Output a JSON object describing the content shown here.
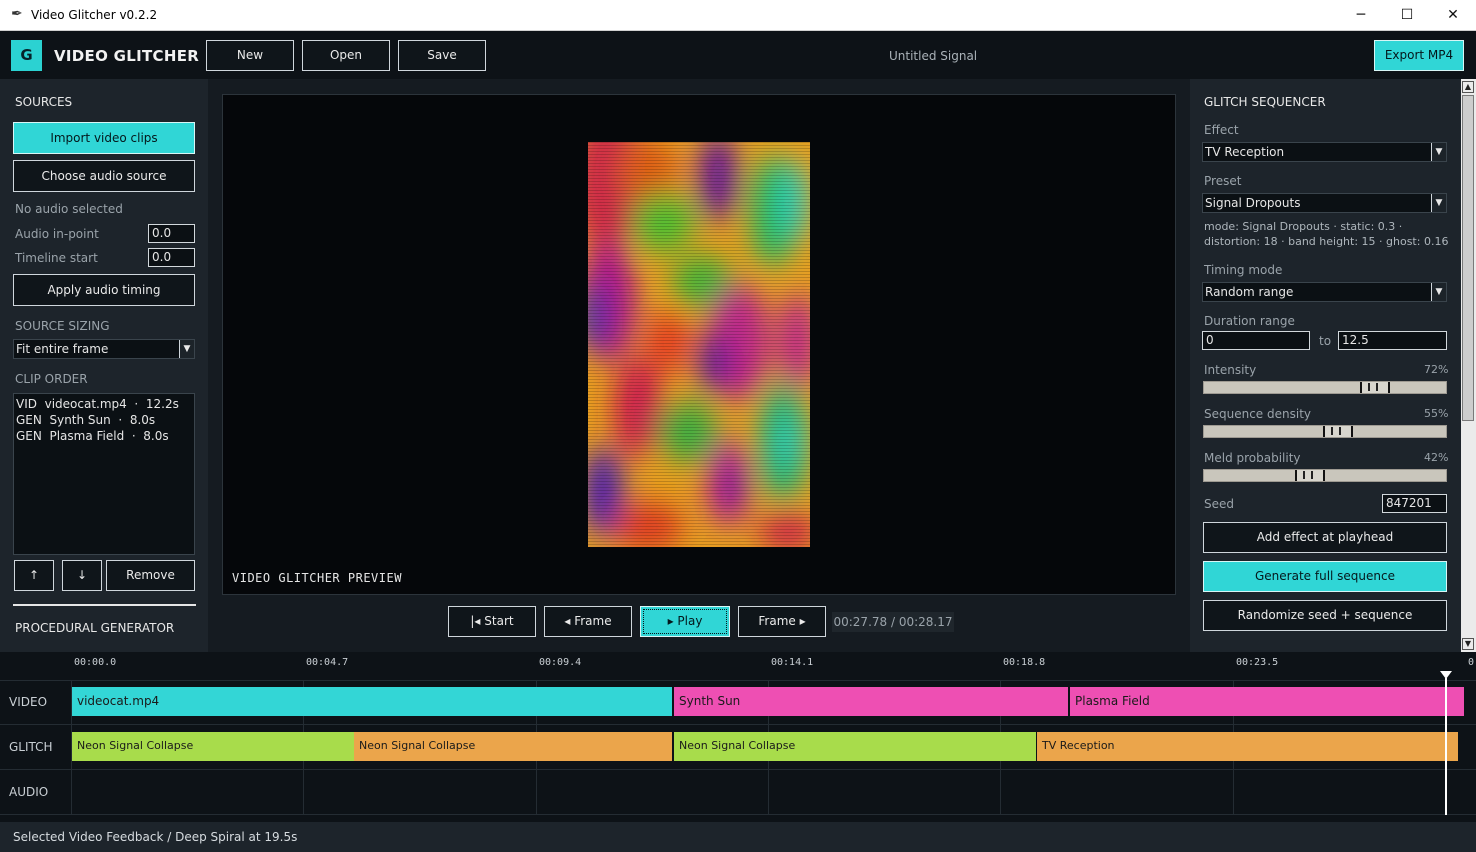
{
  "window": {
    "title": "Video Glitcher v0.2.2",
    "minimize": "─",
    "maximize": "☐",
    "close": "✕",
    "icon": "feather-icon"
  },
  "header": {
    "logo_letter": "G",
    "app_name": "VIDEO GLITCHER",
    "new_label": "New",
    "open_label": "Open",
    "save_label": "Save",
    "doc_title": "Untitled Signal",
    "export_label": "Export MP4"
  },
  "sources": {
    "heading": "SOURCES",
    "import_label": "Import video clips",
    "audio_source_label": "Choose audio source",
    "audio_status": "No audio selected",
    "audio_in_label": "Audio in-point",
    "audio_in_value": "0.0",
    "timeline_start_label": "Timeline start",
    "timeline_start_value": "0.0",
    "apply_timing_label": "Apply audio timing",
    "sizing_heading": "SOURCE SIZING",
    "sizing_value": "Fit entire frame",
    "clip_order_heading": "CLIP ORDER",
    "clips": [
      "VID  videocat.mp4  ·  12.2s",
      "GEN  Synth Sun  ·  8.0s",
      "GEN  Plasma Field  ·  8.0s"
    ],
    "up_label": "↑",
    "down_label": "↓",
    "remove_label": "Remove",
    "procedural_heading": "PROCEDURAL GENERATOR"
  },
  "preview": {
    "label": "VIDEO GLITCHER PREVIEW",
    "start_label": "|◂ Start",
    "frame_back_label": "◂ Frame",
    "play_label": "▸ Play",
    "frame_fwd_label": "Frame ▸",
    "timecode": "00:27.78 / 00:28.17"
  },
  "sequencer": {
    "heading": "GLITCH SEQUENCER",
    "effect_label": "Effect",
    "effect_value": "TV Reception",
    "preset_label": "Preset",
    "preset_value": "Signal Dropouts",
    "preset_desc_1": "mode: Signal Dropouts · static: 0.3 ·",
    "preset_desc_2": "distortion: 18 · band height: 15 · ghost: 0.16",
    "timing_label": "Timing mode",
    "timing_value": "Random range",
    "duration_label": "Duration range",
    "duration_min": "0",
    "duration_to": "to",
    "duration_max": "12.5",
    "intensity_label": "Intensity",
    "intensity_value": "72%",
    "intensity": 0.72,
    "density_label": "Sequence density",
    "density_value": "55%",
    "density": 0.55,
    "meld_label": "Meld probability",
    "meld_value": "42%",
    "meld": 0.42,
    "seed_label": "Seed",
    "seed_value": "847201",
    "add_effect_label": "Add effect at playhead",
    "generate_label": "Generate full sequence",
    "randomize_label": "Randomize seed + sequence",
    "scroll_up": "▲",
    "scroll_down": "▼"
  },
  "timeline": {
    "ruler": [
      "00:00.0",
      "00:04.7",
      "00:09.4",
      "00:14.1",
      "00:18.8",
      "00:23.5",
      "0"
    ],
    "tracks": [
      "VIDEO",
      "GLITCH",
      "AUDIO"
    ],
    "video_clips": [
      {
        "label": "videocat.mp4",
        "color": "#33d6d6"
      },
      {
        "label": "Synth Sun",
        "color": "#ee4fb3"
      },
      {
        "label": "Plasma Field",
        "color": "#ee4fb3"
      }
    ],
    "glitch_clips": [
      {
        "label": "Neon Signal Collapse",
        "color": "#a8dc4b"
      },
      {
        "label": "Neon Signal Collapse",
        "color": "#eba54b"
      },
      {
        "label": "Neon Signal Collapse",
        "color": "#a8dc4b"
      },
      {
        "label": "TV Reception",
        "color": "#eba54b"
      }
    ],
    "playhead_time": "00:27.78"
  },
  "status": {
    "text": "Selected Video Feedback / Deep Spiral at 19.5s"
  },
  "colors": {
    "accent": "#30d6d6",
    "panel": "#1d242b",
    "background": "#151b21"
  }
}
